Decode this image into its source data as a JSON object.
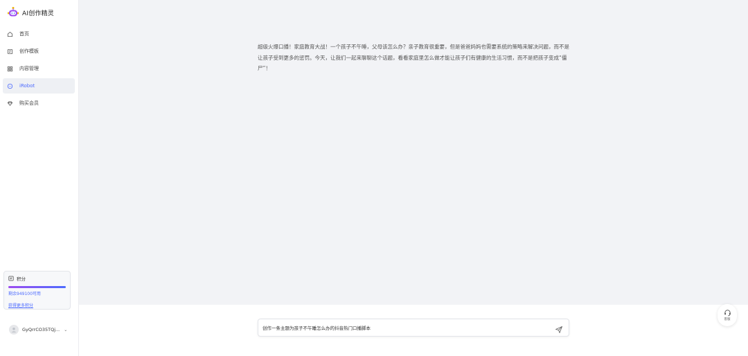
{
  "brand": {
    "title": "AI创作精灵",
    "accent": "#4d6bfe",
    "logo_color": "#9d4cf0"
  },
  "nav": {
    "items": [
      {
        "label": "首页",
        "icon": "home-icon",
        "active": false
      },
      {
        "label": "创作模板",
        "icon": "template-icon",
        "active": false
      },
      {
        "label": "内容管理",
        "icon": "grid-icon",
        "active": false
      },
      {
        "label": "iRobot",
        "icon": "robot-icon",
        "active": true
      },
      {
        "label": "购买会员",
        "icon": "diamond-icon",
        "active": false
      }
    ]
  },
  "points": {
    "title": "积分",
    "remaining": "剩余949100可用",
    "link": "获得更多积分",
    "level": 1.0
  },
  "user": {
    "name": "GyQrrCO35TQj..."
  },
  "chat": {
    "message": "超级火爆口播！家庭教育大战！一个孩子不午睡，父母该怎么办？亲子教育很重要，但是爸爸妈妈也需要系统的策略来解决问题，而不是让孩子受到更多的惩罚。今天，让我们一起来聊聊这个话题，看看家庭里怎么做才能让孩子们有健康的生活习惯，而不是把孩子变成“僵尸”！"
  },
  "composer": {
    "value": "创作一条主题为孩子不午睡怎么办的抖音热门口播脚本"
  },
  "service": {
    "label": "客服"
  }
}
